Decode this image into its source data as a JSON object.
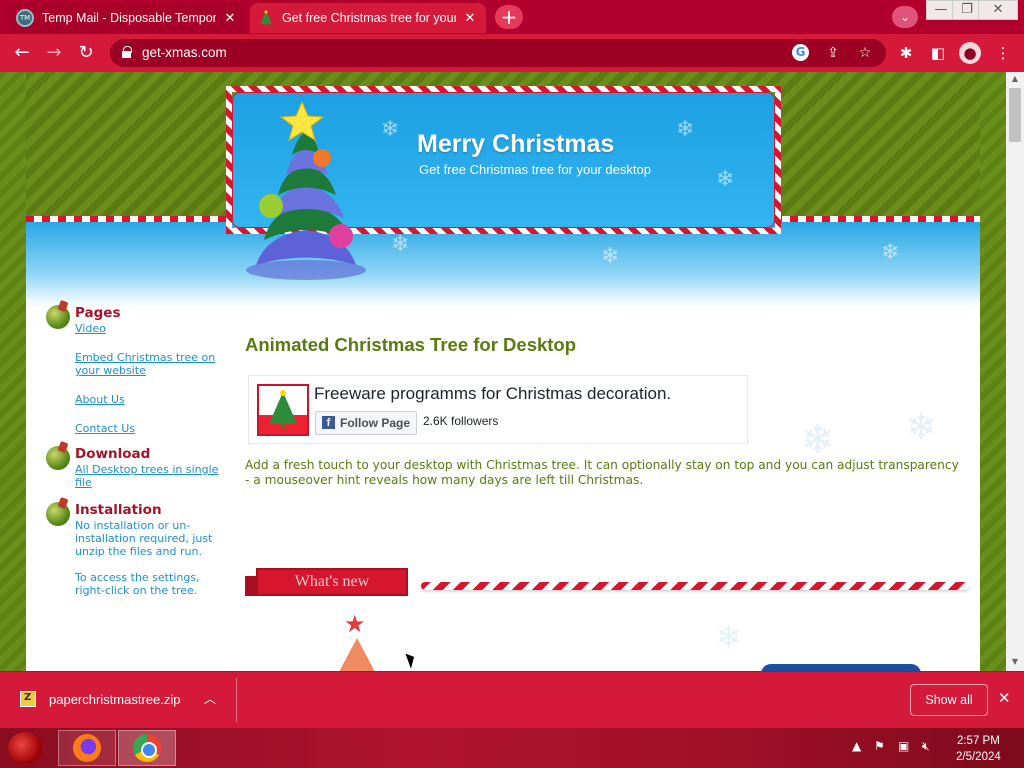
{
  "browser": {
    "tabs": [
      {
        "title": "Temp Mail - Disposable Tempora",
        "active": false
      },
      {
        "title": "Get free Christmas tree for your d",
        "active": true
      }
    ],
    "url": "get-xmas.com",
    "window_controls": {
      "minimize": "—",
      "restore": "❐",
      "close": "✕"
    }
  },
  "header": {
    "title": "Merry Christmas",
    "subtitle": "Get free Christmas tree for your desktop"
  },
  "sidebar": {
    "pages_heading": "Pages",
    "pages_links": [
      "Video",
      "Embed Christmas tree on your website",
      "About Us",
      "Contact Us"
    ],
    "download_heading": "Download",
    "download_link": "All Desktop trees in single file",
    "installation_heading": "Installation",
    "installation_text_1": "No installation or un-installation required, just unzip the files and run.",
    "installation_text_2": "To access the settings, right-click on the tree."
  },
  "main": {
    "title": "Animated Christmas Tree for Desktop",
    "fb_page_name": "Freeware programms for Christmas decoration.",
    "fb_follow_label": "Follow Page",
    "fb_followers": "2.6K followers",
    "description": "Add a fresh touch to your desktop with Christmas tree. It can optionally stay on top and you can adjust transparency - a mouseover hint reveals how many days are left till Christmas.",
    "whats_new": "What's new"
  },
  "download_bar": {
    "file_name": "paperchristmastree.zip",
    "show_all": "Show all"
  },
  "taskbar": {
    "time": "2:57 PM",
    "date": "2/5/2024"
  },
  "colors": {
    "chrome_red": "#d4193a",
    "page_green": "#5a7a10",
    "heading_red": "#a3142b",
    "link_blue": "#1f8fd4"
  }
}
